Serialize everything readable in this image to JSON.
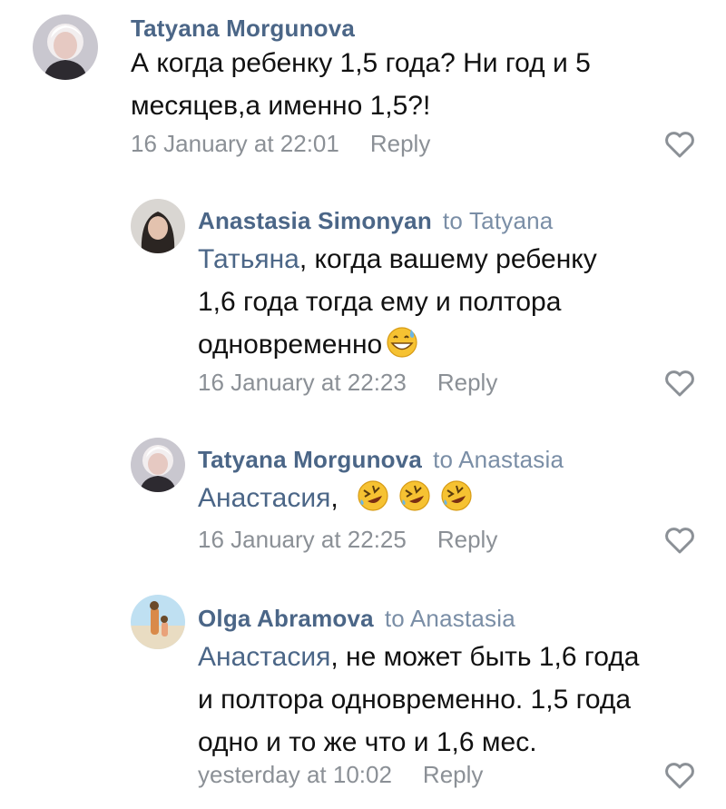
{
  "comments": [
    {
      "author": "Tatyana Morgunova",
      "reply_to": "",
      "mention": "",
      "lines": [
        "А когда ребенку 1,5 года? Ни год и 5",
        "месяцев,а именно 1,5?!"
      ],
      "time": "16 January at 22:01",
      "reply_label": "Reply",
      "avatar": "avatar-tatyana",
      "emoji": []
    },
    {
      "author": "Anastasia Simonyan",
      "reply_to": "to Tatyana",
      "mention": "Татьяна",
      "lines": [
        ", когда вашему ребенку",
        "1,6 года тогда ему и полтора",
        "одновременно"
      ],
      "time": "16 January at 22:23",
      "reply_label": "Reply",
      "avatar": "avatar-anastasia",
      "emoji": [
        "grinning-sweat-emoji"
      ]
    },
    {
      "author": "Tatyana Morgunova",
      "reply_to": "to Anastasia",
      "mention": "Анастасия",
      "lines": [
        ","
      ],
      "time": "16 January at 22:25",
      "reply_label": "Reply",
      "avatar": "avatar-tatyana",
      "emoji": [
        "rofl-emoji",
        "rofl-emoji",
        "rofl-emoji"
      ]
    },
    {
      "author": "Olga Abramova",
      "reply_to": "to Anastasia",
      "mention": "Анастасия",
      "lines": [
        ", не может быть 1,6 года",
        "и полтора одновременно. 1,5 года",
        "одно и то же что и 1,6 мес."
      ],
      "time": "yesterday at 10:02",
      "reply_label": "Reply",
      "avatar": "avatar-olga",
      "emoji": []
    }
  ],
  "colors": {
    "author": "#4b6687",
    "mention": "#4b6687",
    "meta": "#8b9096",
    "text": "#111111"
  },
  "icons": {
    "like": "heart-outline-icon"
  }
}
